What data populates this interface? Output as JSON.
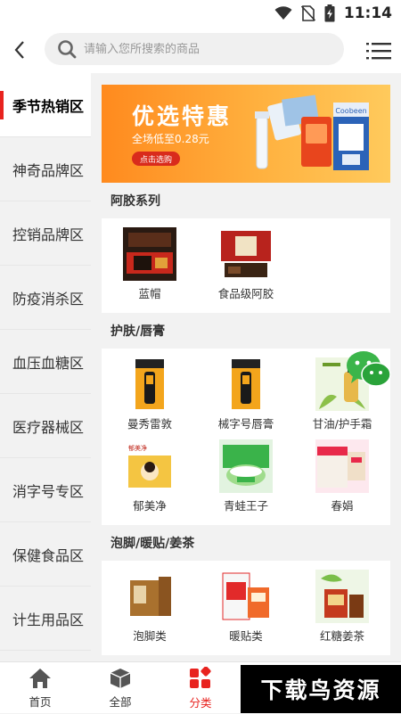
{
  "status_bar": {
    "time": "11:14"
  },
  "search": {
    "placeholder": "请输入您所搜索的商品"
  },
  "sidebar": {
    "items": [
      {
        "label": "季节热销区"
      },
      {
        "label": "神奇品牌区"
      },
      {
        "label": "控销品牌区"
      },
      {
        "label": "防疫消杀区"
      },
      {
        "label": "血压血糖区"
      },
      {
        "label": "医疗器械区"
      },
      {
        "label": "消字号专区"
      },
      {
        "label": "保健食品区"
      },
      {
        "label": "计生用品区"
      }
    ]
  },
  "banner": {
    "title": "优选特惠",
    "subtitle": "全场低至0.28元",
    "button_label": "点击选购",
    "product_brand": "Coobeen"
  },
  "sections": [
    {
      "title": "阿胶系列",
      "items": [
        {
          "label": "蓝帽",
          "icon": "ejiao-gift-box-icon"
        },
        {
          "label": "食品级阿胶",
          "icon": "ejiao-red-box-icon"
        }
      ]
    },
    {
      "title": "护肤/唇膏",
      "items": [
        {
          "label": "曼秀雷敦",
          "icon": "lip-balm-icon"
        },
        {
          "label": "械字号唇膏",
          "icon": "lip-balm-icon"
        },
        {
          "label": "甘油/护手霜",
          "icon": "glycerin-bottle-icon"
        },
        {
          "label": "郁美净",
          "icon": "cream-box-icon"
        },
        {
          "label": "青蛙王子",
          "icon": "frog-prince-cream-icon"
        },
        {
          "label": "春娟",
          "icon": "chunjuan-box-icon"
        }
      ]
    },
    {
      "title": "泡脚/暖贴/姜茶",
      "items": [
        {
          "label": "泡脚类",
          "icon": "foot-soak-box-icon"
        },
        {
          "label": "暖贴类",
          "icon": "warm-patch-icon"
        },
        {
          "label": "红糖姜茶",
          "icon": "ginger-tea-icon"
        }
      ]
    }
  ],
  "tabbar": {
    "items": [
      {
        "label": "首页"
      },
      {
        "label": "全部"
      },
      {
        "label": "分类"
      }
    ]
  },
  "watermark": {
    "text": "下载鸟资源"
  },
  "colors": {
    "accent": "#e8231f",
    "banner": "#ff9a2a"
  }
}
